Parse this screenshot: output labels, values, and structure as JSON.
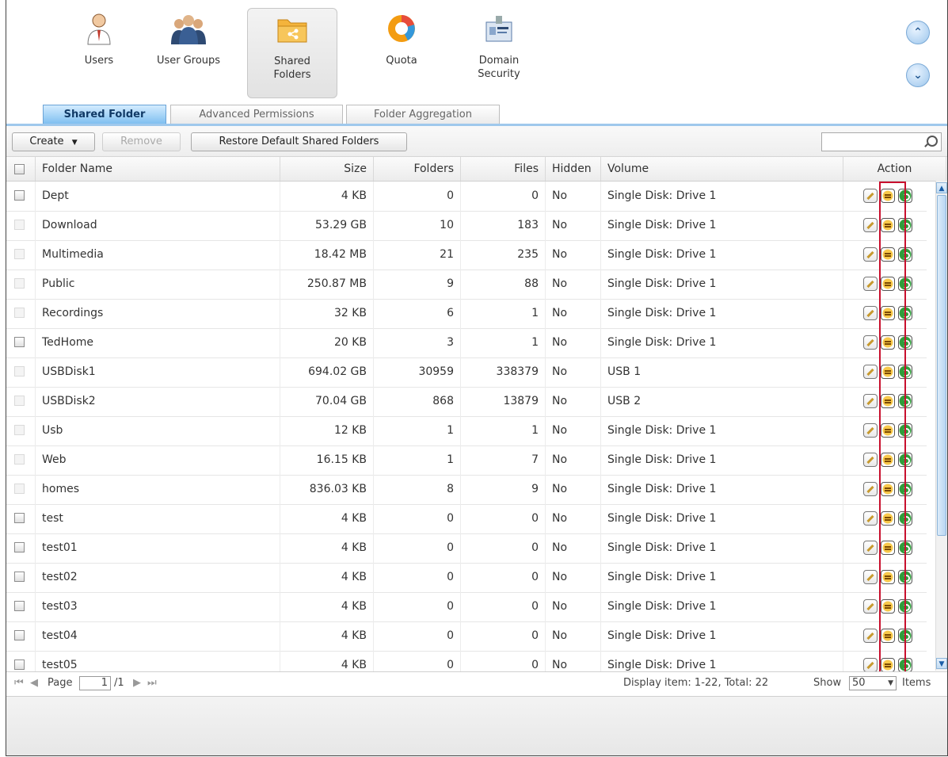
{
  "nav": [
    {
      "label": "Users",
      "icon": "user-icon"
    },
    {
      "label": "User Groups",
      "icon": "user-group-icon"
    },
    {
      "label": "Shared\nFolders",
      "icon": "shared-folder-icon"
    },
    {
      "label": "Quota",
      "icon": "quota-pie-icon"
    },
    {
      "label": "Domain\nSecurity",
      "icon": "domain-security-icon"
    }
  ],
  "tabs": [
    "Shared Folder",
    "Advanced Permissions",
    "Folder Aggregation"
  ],
  "toolbar": {
    "create": "Create",
    "remove": "Remove",
    "restore": "Restore Default Shared Folders"
  },
  "columns": [
    "Folder Name",
    "Size",
    "Folders",
    "Files",
    "Hidden",
    "Volume",
    "Action"
  ],
  "rows": [
    {
      "name": "Dept",
      "size": "4 KB",
      "folders": "0",
      "files": "0",
      "hidden": "No",
      "volume": "Single Disk: Drive 1",
      "checkbox": "enabled"
    },
    {
      "name": "Download",
      "size": "53.29 GB",
      "folders": "10",
      "files": "183",
      "hidden": "No",
      "volume": "Single Disk: Drive 1",
      "checkbox": "disabled"
    },
    {
      "name": "Multimedia",
      "size": "18.42 MB",
      "folders": "21",
      "files": "235",
      "hidden": "No",
      "volume": "Single Disk: Drive 1",
      "checkbox": "disabled"
    },
    {
      "name": "Public",
      "size": "250.87 MB",
      "folders": "9",
      "files": "88",
      "hidden": "No",
      "volume": "Single Disk: Drive 1",
      "checkbox": "disabled"
    },
    {
      "name": "Recordings",
      "size": "32 KB",
      "folders": "6",
      "files": "1",
      "hidden": "No",
      "volume": "Single Disk: Drive 1",
      "checkbox": "disabled"
    },
    {
      "name": "TedHome",
      "size": "20 KB",
      "folders": "3",
      "files": "1",
      "hidden": "No",
      "volume": "Single Disk: Drive 1",
      "checkbox": "enabled"
    },
    {
      "name": "USBDisk1",
      "size": "694.02 GB",
      "folders": "30959",
      "files": "338379",
      "hidden": "No",
      "volume": "USB 1",
      "checkbox": "disabled"
    },
    {
      "name": "USBDisk2",
      "size": "70.04 GB",
      "folders": "868",
      "files": "13879",
      "hidden": "No",
      "volume": "USB 2",
      "checkbox": "disabled"
    },
    {
      "name": "Usb",
      "size": "12 KB",
      "folders": "1",
      "files": "1",
      "hidden": "No",
      "volume": "Single Disk: Drive 1",
      "checkbox": "disabled"
    },
    {
      "name": "Web",
      "size": "16.15 KB",
      "folders": "1",
      "files": "7",
      "hidden": "No",
      "volume": "Single Disk: Drive 1",
      "checkbox": "disabled"
    },
    {
      "name": "homes",
      "size": "836.03 KB",
      "folders": "8",
      "files": "9",
      "hidden": "No",
      "volume": "Single Disk: Drive 1",
      "checkbox": "disabled"
    },
    {
      "name": "test",
      "size": "4 KB",
      "folders": "0",
      "files": "0",
      "hidden": "No",
      "volume": "Single Disk: Drive 1",
      "checkbox": "enabled"
    },
    {
      "name": "test01",
      "size": "4 KB",
      "folders": "0",
      "files": "0",
      "hidden": "No",
      "volume": "Single Disk: Drive 1",
      "checkbox": "enabled"
    },
    {
      "name": "test02",
      "size": "4 KB",
      "folders": "0",
      "files": "0",
      "hidden": "No",
      "volume": "Single Disk: Drive 1",
      "checkbox": "enabled"
    },
    {
      "name": "test03",
      "size": "4 KB",
      "folders": "0",
      "files": "0",
      "hidden": "No",
      "volume": "Single Disk: Drive 1",
      "checkbox": "enabled"
    },
    {
      "name": "test04",
      "size": "4 KB",
      "folders": "0",
      "files": "0",
      "hidden": "No",
      "volume": "Single Disk: Drive 1",
      "checkbox": "enabled"
    },
    {
      "name": "test05",
      "size": "4 KB",
      "folders": "0",
      "files": "0",
      "hidden": "No",
      "volume": "Single Disk: Drive 1",
      "checkbox": "enabled"
    }
  ],
  "pager": {
    "page_label": "Page",
    "page_value": "1",
    "page_total": "/1",
    "display": "Display item: 1-22, Total: 22",
    "show_label": "Show",
    "show_value": "50",
    "items_label": "Items"
  },
  "colors": {
    "highlight": "#c8102e",
    "active_tab": "#7fbff0"
  }
}
